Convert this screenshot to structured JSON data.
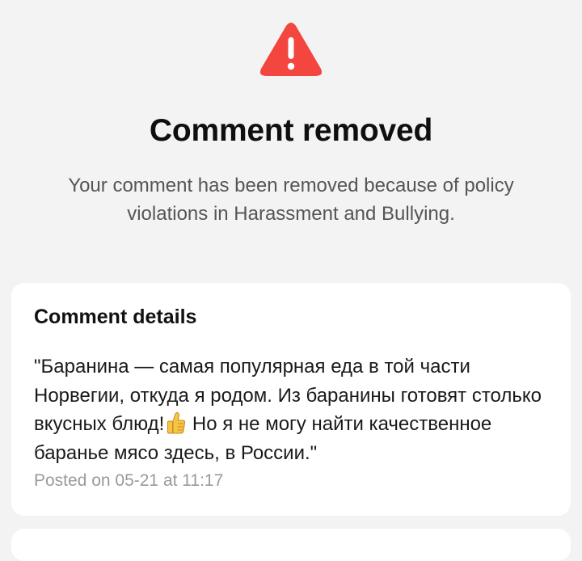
{
  "header": {
    "icon": "warning-triangle-icon",
    "title": "Comment removed",
    "subtitle": "Your comment has been removed because of policy violations in Harassment and Bullying."
  },
  "comment_details": {
    "title": "Comment details",
    "text_before_emoji": "\"Баранина — самая популярная еда в той части Норвегии, откуда я родом. Из баранины готовят столько вкусных блюд!",
    "emoji": "thumbs-up-icon",
    "text_after_emoji": " Но я не могу найти качественное баранье мясо здесь, в России.\"",
    "posted": "Posted on 05-21 at 11:17"
  },
  "colors": {
    "background": "#f3f3f3",
    "warning_red": "#f2463e",
    "card": "#ffffff",
    "muted_text": "#9a9a9a"
  }
}
